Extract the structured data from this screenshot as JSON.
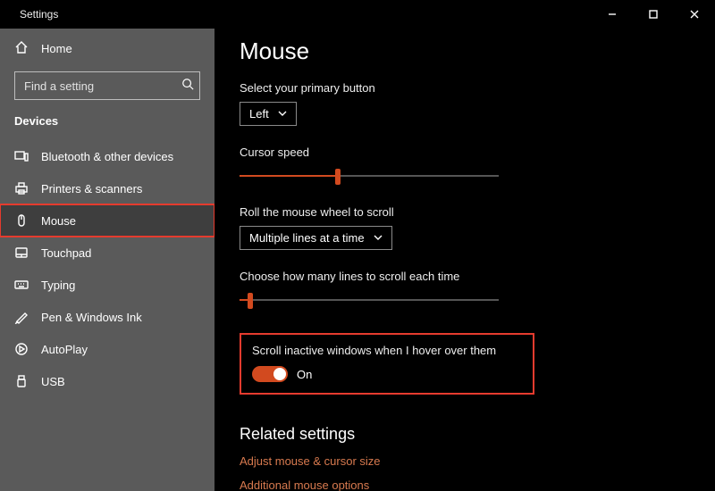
{
  "titlebar": {
    "title": "Settings"
  },
  "sidebar": {
    "home_label": "Home",
    "search_placeholder": "Find a setting",
    "section_label": "Devices",
    "items": [
      {
        "label": "Bluetooth & other devices"
      },
      {
        "label": "Printers & scanners"
      },
      {
        "label": "Mouse"
      },
      {
        "label": "Touchpad"
      },
      {
        "label": "Typing"
      },
      {
        "label": "Pen & Windows Ink"
      },
      {
        "label": "AutoPlay"
      },
      {
        "label": "USB"
      }
    ]
  },
  "main": {
    "page_title": "Mouse",
    "primary_button_label": "Select your primary button",
    "primary_button_value": "Left",
    "cursor_speed_label": "Cursor speed",
    "cursor_speed_percent": 38,
    "wheel_scroll_label": "Roll the mouse wheel to scroll",
    "wheel_scroll_value": "Multiple lines at a time",
    "lines_label": "Choose how many lines to scroll each time",
    "lines_percent": 4,
    "hover_label": "Scroll inactive windows when I hover over them",
    "hover_state": "On",
    "related_heading": "Related settings",
    "link_adjust": "Adjust mouse & cursor size",
    "link_additional": "Additional mouse options"
  }
}
